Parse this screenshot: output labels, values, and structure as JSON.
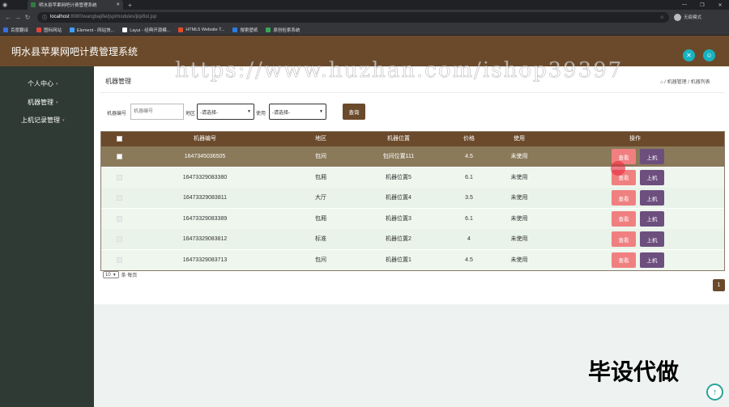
{
  "browser": {
    "tab_title": "明水县苹果网吧计费管理系统",
    "url_host": "localhost",
    "url_path": ":8080/wangbajifei/jsp/modules/jiqi/list.jsp",
    "profile_label": "无痕模式",
    "bookmarks": [
      {
        "label": "百度翻译",
        "color": "#3b6fe0"
      },
      {
        "label": "图标网站",
        "color": "#e0443b"
      },
      {
        "label": "Element - 网站快...",
        "color": "#409eff"
      },
      {
        "label": "Layui - 经典开源模...",
        "color": "#ffffff"
      },
      {
        "label": "HTML5 Website T...",
        "color": "#e34c26"
      },
      {
        "label": "搜索壁纸",
        "color": "#2d7be0"
      },
      {
        "label": "原创检索系统",
        "color": "#3aa655"
      }
    ]
  },
  "app": {
    "title": "明水县苹果网吧计费管理系统"
  },
  "sidebar": {
    "items": [
      {
        "label": "个人中心"
      },
      {
        "label": "机器管理"
      },
      {
        "label": "上机记录管理"
      }
    ]
  },
  "page": {
    "title": "机器管理",
    "breadcrumb_1": "机器管理",
    "breadcrumb_2": "机器列表"
  },
  "filters": {
    "number_label": "机器编号",
    "number_placeholder": "机器编号",
    "area_label": "地区",
    "area_value": "-请选择-",
    "usage_label": "使用",
    "usage_value": "-请选择-",
    "query_label": "查询"
  },
  "table": {
    "headers": [
      "机器编号",
      "地区",
      "机器位置",
      "价格",
      "使用",
      "操作"
    ],
    "rows": [
      {
        "number": "1647345036505",
        "area": "包间",
        "position": "包间位置111",
        "price": "4.5",
        "usage": "未使用"
      },
      {
        "number": "16473329083380",
        "area": "包厢",
        "position": "机器位置5",
        "price": "6.1",
        "usage": "未使用"
      },
      {
        "number": "16473329083811",
        "area": "大厅",
        "position": "机器位置4",
        "price": "3.5",
        "usage": "未使用"
      },
      {
        "number": "16473329083389",
        "area": "包厢",
        "position": "机器位置3",
        "price": "6.1",
        "usage": "未使用"
      },
      {
        "number": "16473329083812",
        "area": "标准",
        "position": "机器位置2",
        "price": "4",
        "usage": "未使用"
      },
      {
        "number": "16473329083713",
        "area": "包间",
        "position": "机器位置1",
        "price": "4.5",
        "usage": "未使用"
      }
    ],
    "view_label": "查看",
    "online_label": "上机"
  },
  "pagination": {
    "page_size": "10",
    "per_page_text": "条 每页",
    "current_page": "1"
  },
  "overlay": {
    "watermark": "https://www.huzhan.com/ishop39397",
    "stamp": "毕设代做"
  },
  "colors": {
    "header": "#6b4a2b",
    "sidebar": "#2e3a33",
    "accent_icon": "#17b3c1",
    "view_button": "#f08080",
    "online_button": "#6d4f7e"
  }
}
